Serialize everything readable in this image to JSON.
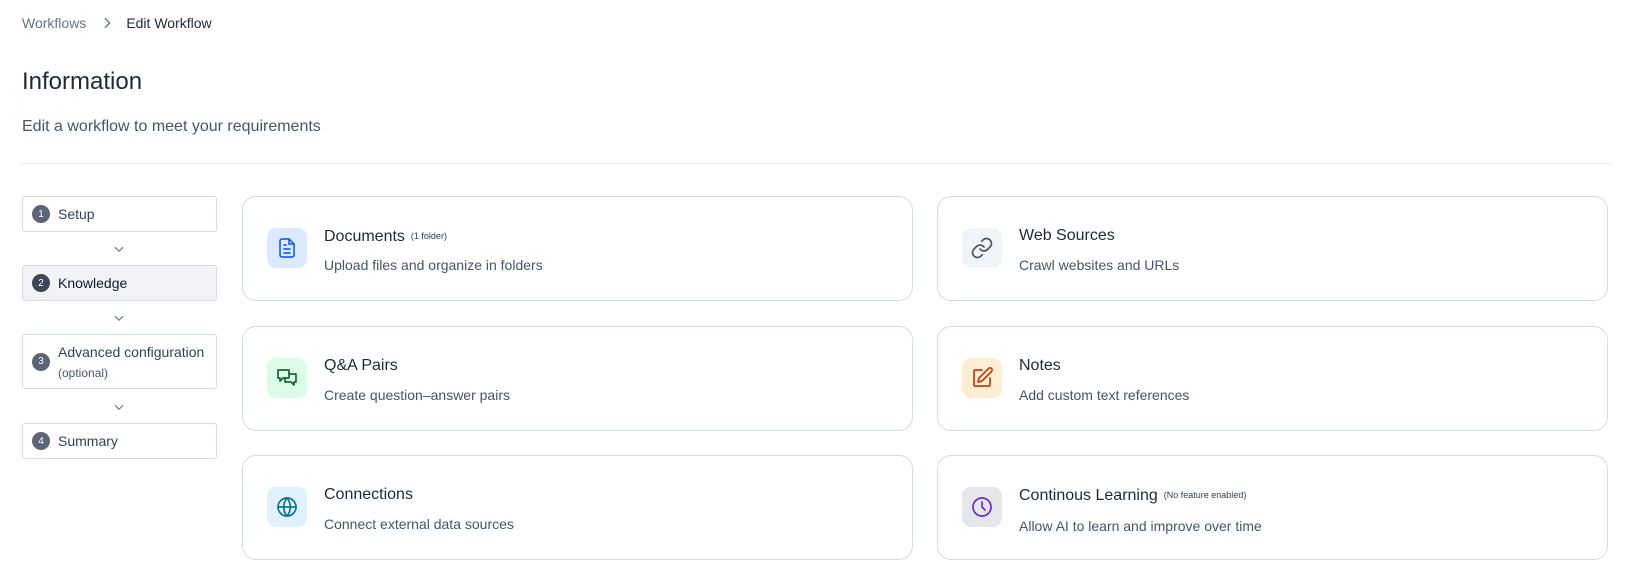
{
  "breadcrumb": {
    "parent": "Workflows",
    "current": "Edit Workflow"
  },
  "page": {
    "title": "Information",
    "subtitle": "Edit a workflow to meet your requirements"
  },
  "steps": [
    {
      "number": "1",
      "label": "Setup",
      "optional": "",
      "active": false
    },
    {
      "number": "2",
      "label": "Knowledge",
      "optional": "",
      "active": true
    },
    {
      "number": "3",
      "label": "Advanced configuration",
      "optional": "(optional)",
      "active": false
    },
    {
      "number": "4",
      "label": "Summary",
      "optional": "",
      "active": false
    }
  ],
  "cards": [
    {
      "title": "Documents",
      "badge": "(1 folder)",
      "description": "Upload files and organize in folders",
      "icon": "document-icon",
      "icon_bg": "#dbeafe",
      "icon_color": "#2563eb"
    },
    {
      "title": "Web Sources",
      "badge": "",
      "description": "Crawl websites and URLs",
      "icon": "link-icon",
      "icon_bg": "#f1f5f9",
      "icon_color": "#475569"
    },
    {
      "title": "Q&A Pairs",
      "badge": "",
      "description": "Create question–answer pairs",
      "icon": "chat-bubbles-icon",
      "icon_bg": "#dcfce7",
      "icon_color": "#166534"
    },
    {
      "title": "Notes",
      "badge": "",
      "description": "Add custom text references",
      "icon": "edit-note-icon",
      "icon_bg": "#ffedd5",
      "icon_color": "#c2410c"
    },
    {
      "title": "Connections",
      "badge": "",
      "description": "Connect external data sources",
      "icon": "globe-icon",
      "icon_bg": "#e0f2fe",
      "icon_color": "#0e7490"
    },
    {
      "title": "Continous Learning",
      "badge": "(No feature enabled)",
      "description": "Allow AI to learn and improve over time",
      "icon": "clock-icon",
      "icon_bg": "#e5e7eb",
      "icon_color": "#6d28d9"
    }
  ]
}
